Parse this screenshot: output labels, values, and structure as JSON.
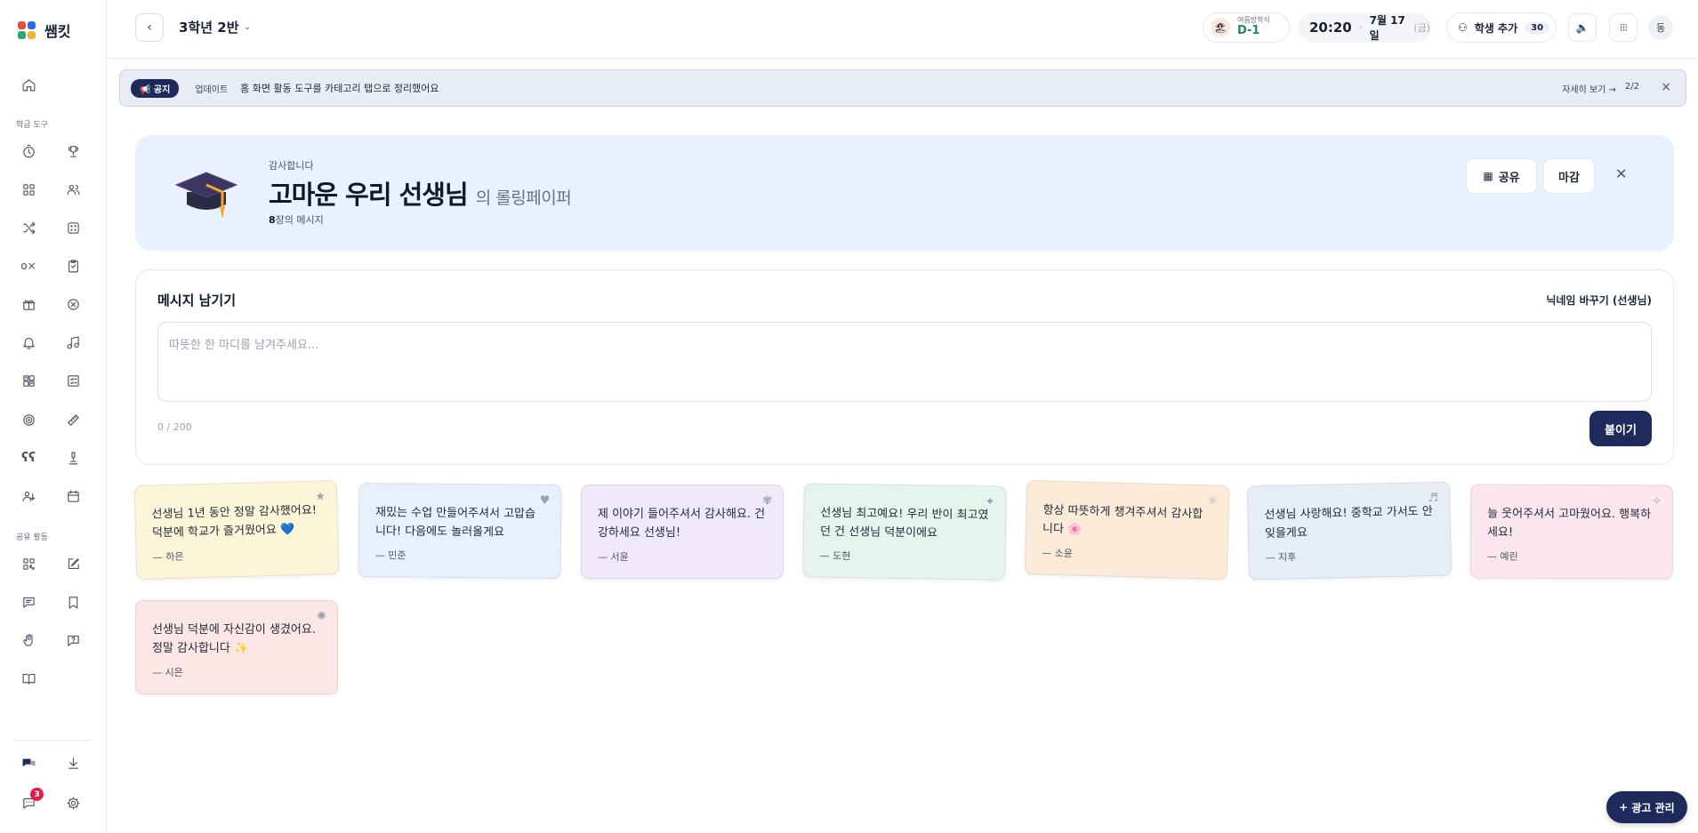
{
  "app": {
    "name": "쌤킷"
  },
  "sidebar": {
    "section_tools": "학급 도구",
    "section_shared": "공유 활동",
    "chat_badge": "3"
  },
  "topbar": {
    "class_name": "3학년 2반",
    "vacation_label": "여름방학식",
    "vacation_dday": "D-1",
    "time": "20:20",
    "date": "7월 17일",
    "weekday": "(금)",
    "add_student_label": "학생 추가",
    "student_count": "30",
    "avatar_initial": "동"
  },
  "notice": {
    "tag": "📢 공지",
    "category": "업데이트",
    "message": "홈 화면 활동 도구를 카테고리 탭으로 정리했어요",
    "more_label": "자세히 보기 →",
    "page": "2/2"
  },
  "hero": {
    "subtitle": "감사합니다",
    "title": "고마운 우리 선생님",
    "title_suffix": "의 롤링페이퍼",
    "count": "8",
    "count_suffix": "장의 메시지",
    "share_label": "공유",
    "close_label": "마감"
  },
  "message_box": {
    "title": "메시지 남기기",
    "nickname_label": "닉네임 바꾸기 (선생님)",
    "placeholder": "따뜻한 한 마디를 남겨주세요...",
    "char_count": "0 / 200",
    "post_label": "붙이기"
  },
  "notes": [
    {
      "text": "선생님 1년 동안 정말 감사했어요! 덕분에 학교가 즐거웠어요 💙",
      "author": "— 하은",
      "color": "#fdf5d8",
      "deco": "★"
    },
    {
      "text": "재밌는 수업 만들어주셔서 고맙습니다! 다음에도 놀러올게요",
      "author": "— 민준",
      "color": "#e7f0fd",
      "deco": "♥"
    },
    {
      "text": "제 이야기 들어주셔서 감사해요. 건강하세요 선생님!",
      "author": "— 서윤",
      "color": "#efe9fb",
      "deco": "✾"
    },
    {
      "text": "선생님 최고예요! 우리 반이 최고였던 건 선생님 덕분이에요",
      "author": "— 도현",
      "color": "#e5f4ec",
      "deco": "✦"
    },
    {
      "text": "항상 따뜻하게 챙겨주셔서 감사합니다 🌸",
      "author": "— 소윤",
      "color": "#fcebd9",
      "deco": "☼"
    },
    {
      "text": "선생님 사랑해요! 중학교 가서도 안 잊을게요",
      "author": "— 지후",
      "color": "#e7edf6",
      "deco": "♬"
    },
    {
      "text": "늘 웃어주셔서 고마웠어요. 행복하세요!",
      "author": "— 예린",
      "color": "#fbe6ef",
      "deco": "✧"
    },
    {
      "text": "선생님 덕분에 자신감이 생겼어요. 정말 감사합니다 ✨",
      "author": "— 시은",
      "color": "#fde6e6",
      "deco": "✺"
    }
  ],
  "ad_button": {
    "label": "광고 관리"
  },
  "colors": {
    "accent": "#1f2a5c",
    "hero_bg": "#e8f1fe",
    "notice_bg": "#e9ecf6"
  }
}
